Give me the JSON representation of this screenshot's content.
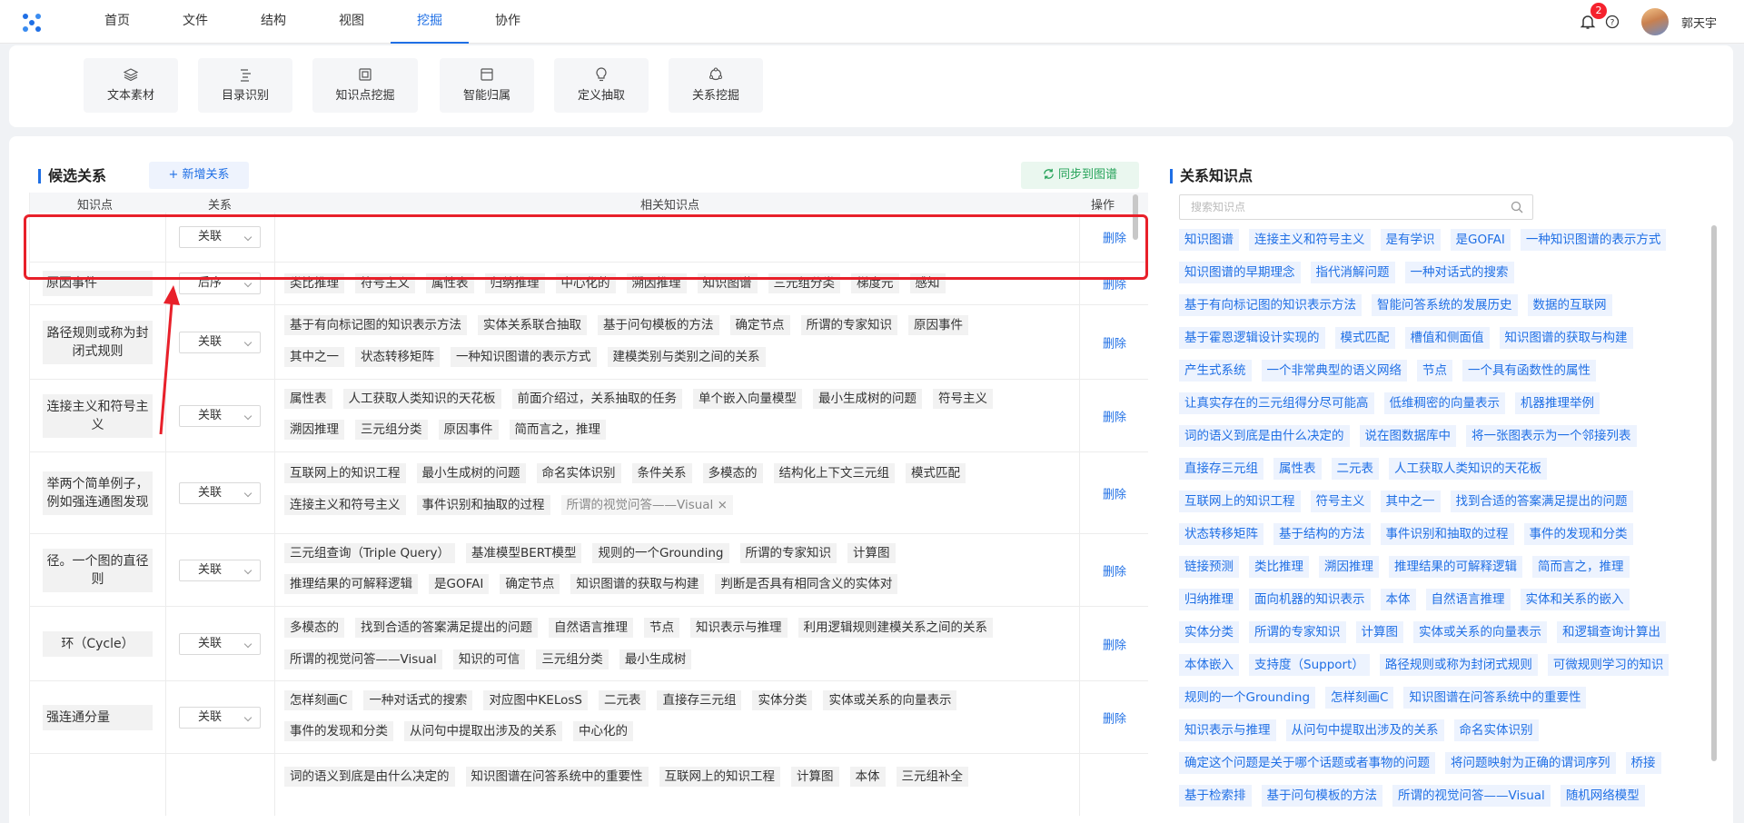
{
  "nav": {
    "items": [
      "首页",
      "文件",
      "结构",
      "视图",
      "挖掘",
      "协作"
    ],
    "active_index": 4
  },
  "header": {
    "notification_count": "2",
    "username": "郭天宇"
  },
  "tools": [
    "文本素材",
    "目录识别",
    "知识点挖掘",
    "智能归属",
    "定义抽取",
    "关系挖掘"
  ],
  "candidate": {
    "title": "候选关系",
    "add_button": "+ 新增关系",
    "sync_button": "同步到图谱",
    "columns": [
      "知识点",
      "关系",
      "相关知识点",
      "操作"
    ],
    "delete_label": "删除",
    "rows": [
      {
        "name": "",
        "relation": "关联",
        "tags": [
          []
        ]
      },
      {
        "name": "原因事件",
        "relation": "后序",
        "tags": [
          [
            "类比推理",
            "符号主义",
            "属性表",
            "归纳推理",
            "中心化的",
            "溯因推理",
            "知识图谱",
            "三元组分类",
            "梯度元",
            "感知"
          ]
        ]
      },
      {
        "name": "路径规则或称为封闭式规则",
        "relation": "关联",
        "tags": [
          [
            "基于有向标记图的知识表示方法",
            "实体关系联合抽取",
            "基于问句模板的方法",
            "确定节点",
            "所谓的专家知识",
            "原因事件"
          ],
          [
            "其中之一",
            "状态转移矩阵",
            "一种知识图谱的表示方式",
            "建模类别与类别之间的关系"
          ]
        ]
      },
      {
        "name": "连接主义和符号主义",
        "relation": "关联",
        "tags": [
          [
            "属性表",
            "人工获取人类知识的天花板",
            "前面介绍过，关系抽取的任务",
            "单个嵌入向量模型",
            "最小生成树的问题",
            "符号主义"
          ],
          [
            "溯因推理",
            "三元组分类",
            "原因事件",
            "简而言之，推理"
          ]
        ]
      },
      {
        "name": "举两个简单例子，例如强连通图发现",
        "relation": "关联",
        "tags": [
          [
            "互联网上的知识工程",
            "最小生成树的问题",
            "命名实体识别",
            "条件关系",
            "多模态的",
            "结构化上下文三元组",
            "模式匹配"
          ],
          [
            "连接主义和符号主义",
            "事件识别和抽取的过程"
          ]
        ],
        "muted_tag": "所谓的视觉问答——Visual ×"
      },
      {
        "name": "径。一个图的直径则",
        "relation": "关联",
        "tags": [
          [
            "三元组查询（Triple Query）",
            "基准模型BERT模型",
            "规则的一个Grounding",
            "所谓的专家知识",
            "计算图"
          ],
          [
            "推理结果的可解释逻辑",
            "是GOFAI",
            "确定节点",
            "知识图谱的获取与构建",
            "判断是否具有相同含义的实体对"
          ]
        ]
      },
      {
        "name": "环（Cycle）",
        "relation": "关联",
        "tags": [
          [
            "多模态的",
            "找到合适的答案满足提出的问题",
            "自然语言推理",
            "节点",
            "知识表示与推理",
            "利用逻辑规则建模关系之间的关系"
          ],
          [
            "所谓的视觉问答——Visual",
            "知识的可信",
            "三元组分类",
            "最小生成树"
          ]
        ]
      },
      {
        "name": "强连通分量",
        "relation": "关联",
        "tags": [
          [
            "怎样刻画C",
            "一种对话式的搜索",
            "对应图中KELosS",
            "二元表",
            "直接存三元组",
            "实体分类",
            "实体或关系的向量表示"
          ],
          [
            "事件的发现和分类",
            "从问句中提取出涉及的关系",
            "中心化的"
          ]
        ]
      },
      {
        "name": "",
        "relation": "",
        "tags": [
          [
            "词的语义到底是由什么决定的",
            "知识图谱在问答系统中的重要性",
            "互联网上的知识工程",
            "计算图",
            "本体",
            "三元组补全"
          ]
        ]
      }
    ]
  },
  "knowledge": {
    "title": "关系知识点",
    "search_placeholder": "搜索知识点",
    "lines": [
      [
        "知识图谱",
        "连接主义和符号主义",
        "是有学识",
        "是GOFAI",
        "一种知识图谱的表示方式"
      ],
      [
        "知识图谱的早期理念",
        "指代消解问题",
        "一种对话式的搜索"
      ],
      [
        "基于有向标记图的知识表示方法",
        "智能问答系统的发展历史",
        "数据的互联网"
      ],
      [
        "基于霍恩逻辑设计实现的",
        "模式匹配",
        "槽值和侧面值",
        "知识图谱的获取与构建"
      ],
      [
        "产生式系统",
        "一个非常典型的语义网络",
        "节点",
        "一个具有函数性的属性"
      ],
      [
        "让真实存在的三元组得分尽可能高",
        "低维稠密的向量表示",
        "机器推理举例"
      ],
      [
        "词的语义到底是由什么决定的",
        "说在图数据库中",
        "将一张图表示为一个邻接列表"
      ],
      [
        "直接存三元组",
        "属性表",
        "二元表",
        "人工获取人类知识的天花板"
      ],
      [
        "互联网上的知识工程",
        "符号主义",
        "其中之一",
        "找到合适的答案满足提出的问题"
      ],
      [
        "状态转移矩阵",
        "基于结构的方法",
        "事件识别和抽取的过程",
        "事件的发现和分类"
      ],
      [
        "链接预测",
        "类比推理",
        "溯因推理",
        "推理结果的可解释逻辑",
        "简而言之，推理"
      ],
      [
        "归纳推理",
        "面向机器的知识表示",
        "本体",
        "自然语言推理",
        "实体和关系的嵌入"
      ],
      [
        "实体分类",
        "所谓的专家知识",
        "计算图",
        "实体或关系的向量表示",
        "和逻辑查询计算出"
      ],
      [
        "本体嵌入",
        "支持度（Support）",
        "路径规则或称为封闭式规则",
        "可微规则学习的知识"
      ],
      [
        "规则的一个Grounding",
        "怎样刻画C",
        "知识图谱在问答系统中的重要性"
      ],
      [
        "知识表示与推理",
        "从问句中提取出涉及的关系",
        "命名实体识别"
      ],
      [
        "确定这个问题是关于哪个话题或者事物的问题",
        "将问题映射为正确的谓词序列",
        "桥接"
      ],
      [
        "基于检索排",
        "基于问句模板的方法",
        "所谓的视觉问答——Visual",
        "随机网络模型"
      ]
    ]
  }
}
